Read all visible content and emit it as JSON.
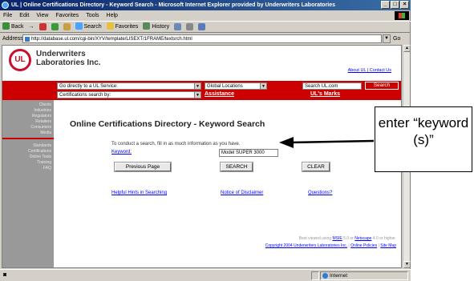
{
  "window": {
    "title": "UL | Online Certifications Directory - Keyword Search - Microsoft Internet Explorer provided by Underwriters Laboratories",
    "buttons": {
      "minimize": "_",
      "maximize": "□",
      "close": "×"
    }
  },
  "menu": [
    "File",
    "Edit",
    "View",
    "Favorites",
    "Tools",
    "Help"
  ],
  "toolbar": {
    "back": "Back",
    "forward": "→",
    "search": "Search",
    "favorites": "Favorites",
    "history": "History"
  },
  "address": {
    "label": "Address",
    "url": "http://database.ul.com/cgi-bin/XYV/template/LISEXT/1FRAME/textsrch.html",
    "go": "Go"
  },
  "header": {
    "logo_text": "UL",
    "company_line1": "Underwriters",
    "company_line2": "Laboratories Inc.",
    "links": "About UL | Contact Us"
  },
  "redbar": {
    "service_select": "Go directly to a UL Service:",
    "cert_select": "Certifications search by:",
    "locations_select": "Global Locations",
    "assistance": "Assistance",
    "search_placeholder": "Search UL.com",
    "search_button": "Search",
    "marks_link": "UL's Marks"
  },
  "sidenav": {
    "group1": [
      "Clients",
      "Industries",
      "Regulators",
      "Retailers",
      "Consumers",
      "Media"
    ],
    "group2": [
      "Standards",
      "Certifications",
      "Online Tools",
      "Training",
      "FAQ"
    ]
  },
  "main": {
    "title": "Online Certifications Directory - Keyword Search",
    "intro": "To conduct a search, fill in as much information as you have.",
    "keyword_label": "Keyword:",
    "keyword_value": "Model SUPER 3000",
    "prev_button": "Previous Page",
    "search_button": "SEARCH",
    "clear_button": "CLEAR",
    "hints_link": "Helpful Hints in Searching",
    "disclaimer_link": "Notice of Disclaimer",
    "questions_link": "Questions?",
    "footer_line1_pre": "Best viewed using",
    "footer_msie": "MSIE",
    "footer_mid": "5.0 or",
    "footer_netscape": "Netscape",
    "footer_line1_post": "4.0 or higher.",
    "footer_copyright": "Copyright 2004 Underwriters Laboratories Inc.",
    "footer_policies": "Online Policies",
    "footer_sitemap": "Site Map"
  },
  "status": {
    "zone": "Internet"
  },
  "callout": {
    "text": "enter “keyword (s)”"
  }
}
